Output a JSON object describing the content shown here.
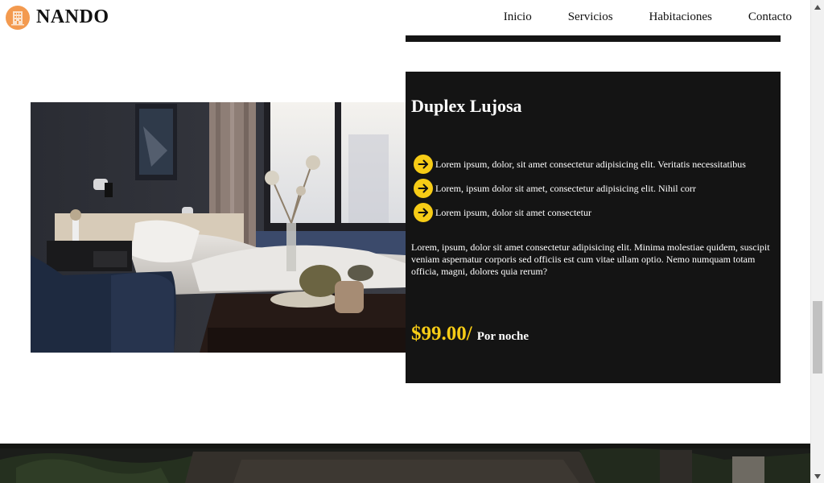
{
  "brand": {
    "name": "NANDO",
    "logo_icon": "hotel-building-icon",
    "logo_color": "#f39a4f"
  },
  "nav": {
    "items": [
      "Inicio",
      "Servicios",
      "Habitaciones",
      "Contacto"
    ]
  },
  "room": {
    "title": "Duplex Lujosa",
    "image": "hotel-room-photo",
    "features": [
      "Lorem ipsum, dolor, sit amet consectetur adipisicing elit. Veritatis necessitatibus",
      "Lorem, ipsum dolor sit amet, consectetur adipisicing elit. Nihil corr",
      "Lorem ipsum, dolor sit amet consectetur"
    ],
    "feature_icon": "arrow-right-circle-icon",
    "description": "Lorem, ipsum, dolor sit amet consectetur adipisicing elit. Minima molestiae quidem, suscipit veniam aspernatur corporis sed officiis est cum vitae ullam optio. Nemo numquam totam officia, magni, dolores quia rerum?",
    "price": "$99.00/",
    "price_unit": "Por noche"
  },
  "colors": {
    "card_bg": "#141414",
    "accent": "#f7cc16"
  }
}
